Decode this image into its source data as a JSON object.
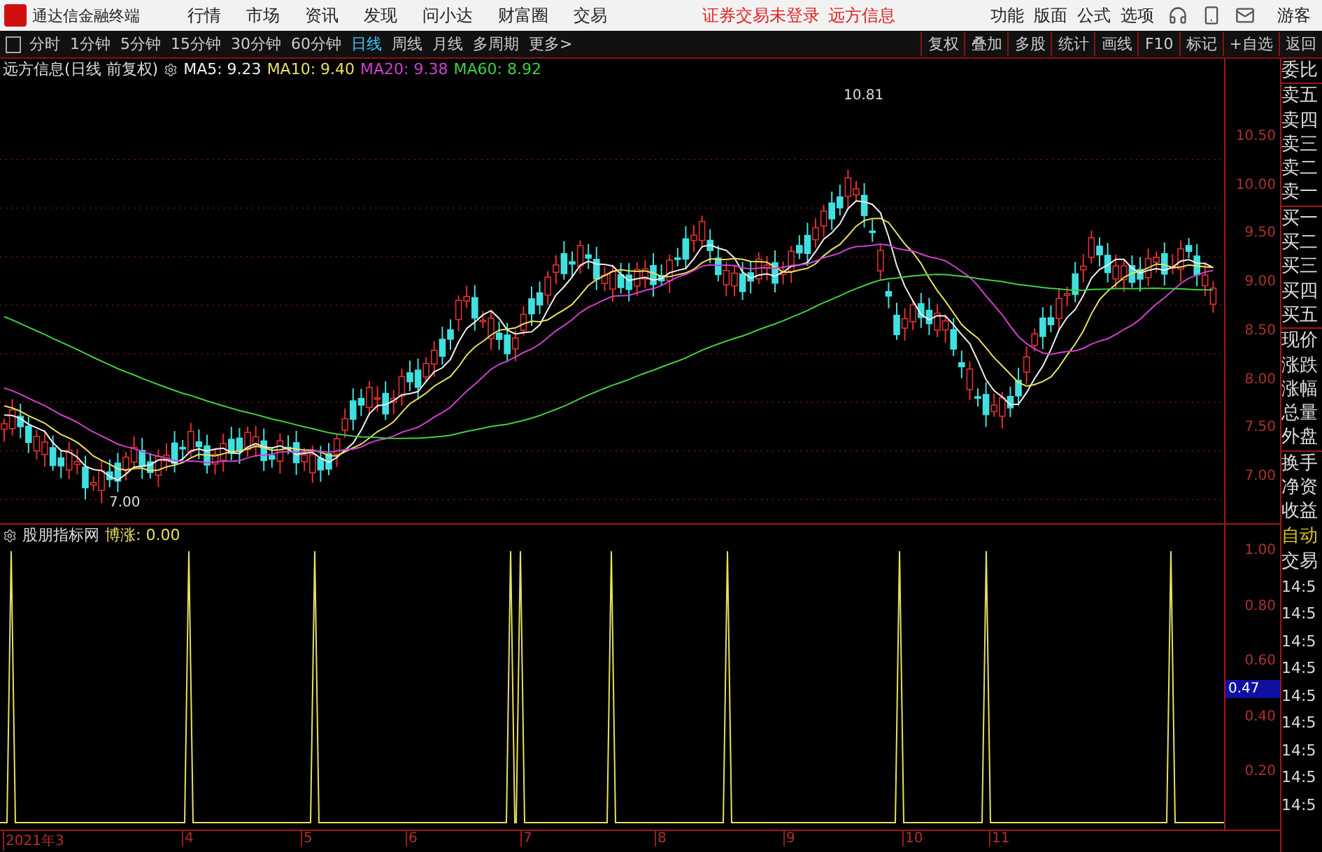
{
  "app": {
    "title": "通达信金融终端"
  },
  "menu": [
    "行情",
    "市场",
    "资讯",
    "发现",
    "问小达",
    "财富圈",
    "交易"
  ],
  "notices": [
    "证券交易未登录",
    "远方信息"
  ],
  "right_menu": [
    "功能",
    "版面",
    "公式",
    "选项"
  ],
  "user": "游客",
  "periods": [
    {
      "label": "分时",
      "selected": false
    },
    {
      "label": "1分钟",
      "selected": false
    },
    {
      "label": "5分钟",
      "selected": false
    },
    {
      "label": "15分钟",
      "selected": false
    },
    {
      "label": "30分钟",
      "selected": false
    },
    {
      "label": "60分钟",
      "selected": false
    },
    {
      "label": "日线",
      "selected": true
    },
    {
      "label": "周线",
      "selected": false
    },
    {
      "label": "月线",
      "selected": false
    },
    {
      "label": "多周期",
      "selected": false
    },
    {
      "label": "更多>",
      "selected": false
    }
  ],
  "tools": [
    "复权",
    "叠加",
    "多股",
    "统计",
    "画线",
    "F10",
    "标记",
    "+自选",
    "返回"
  ],
  "chart": {
    "title": "远方信息(日线 前复权)",
    "mas": [
      {
        "label": "MA5: 9.23",
        "color": "#f0f0f0"
      },
      {
        "label": "MA10: 9.40",
        "color": "#e8e060"
      },
      {
        "label": "MA20: 9.38",
        "color": "#d040d0"
      },
      {
        "label": "MA60: 8.92",
        "color": "#40d040"
      }
    ],
    "high_label": "10.81",
    "low_label": "7.00",
    "yticks": [
      "10.50",
      "10.00",
      "9.50",
      "9.00",
      "8.50",
      "8.00",
      "7.50",
      "7.00"
    ]
  },
  "indicator": {
    "name": "股朋指标网",
    "series_label": "博涨: 0.00",
    "yticks": [
      "1.00",
      "0.80",
      "0.60",
      "0.40",
      "0.20"
    ],
    "cursor_value": "0.47"
  },
  "dates": [
    "2021年3",
    "4",
    "5",
    "6",
    "7",
    "8",
    "9",
    "10",
    "11"
  ],
  "quote_labels": [
    "委比",
    "卖五",
    "卖四",
    "卖三",
    "卖二",
    "卖一",
    "买一",
    "买二",
    "买三",
    "买四",
    "买五",
    "现价",
    "涨跌",
    "涨幅",
    "总量",
    "外盘",
    "换手",
    "净资",
    "收益"
  ],
  "trade": {
    "mode": "自动",
    "title": "交易",
    "times": [
      "14:5",
      "14:5",
      "14:5",
      "14:5",
      "14:5",
      "14:5",
      "14:5",
      "14:5",
      "14:5"
    ]
  }
}
